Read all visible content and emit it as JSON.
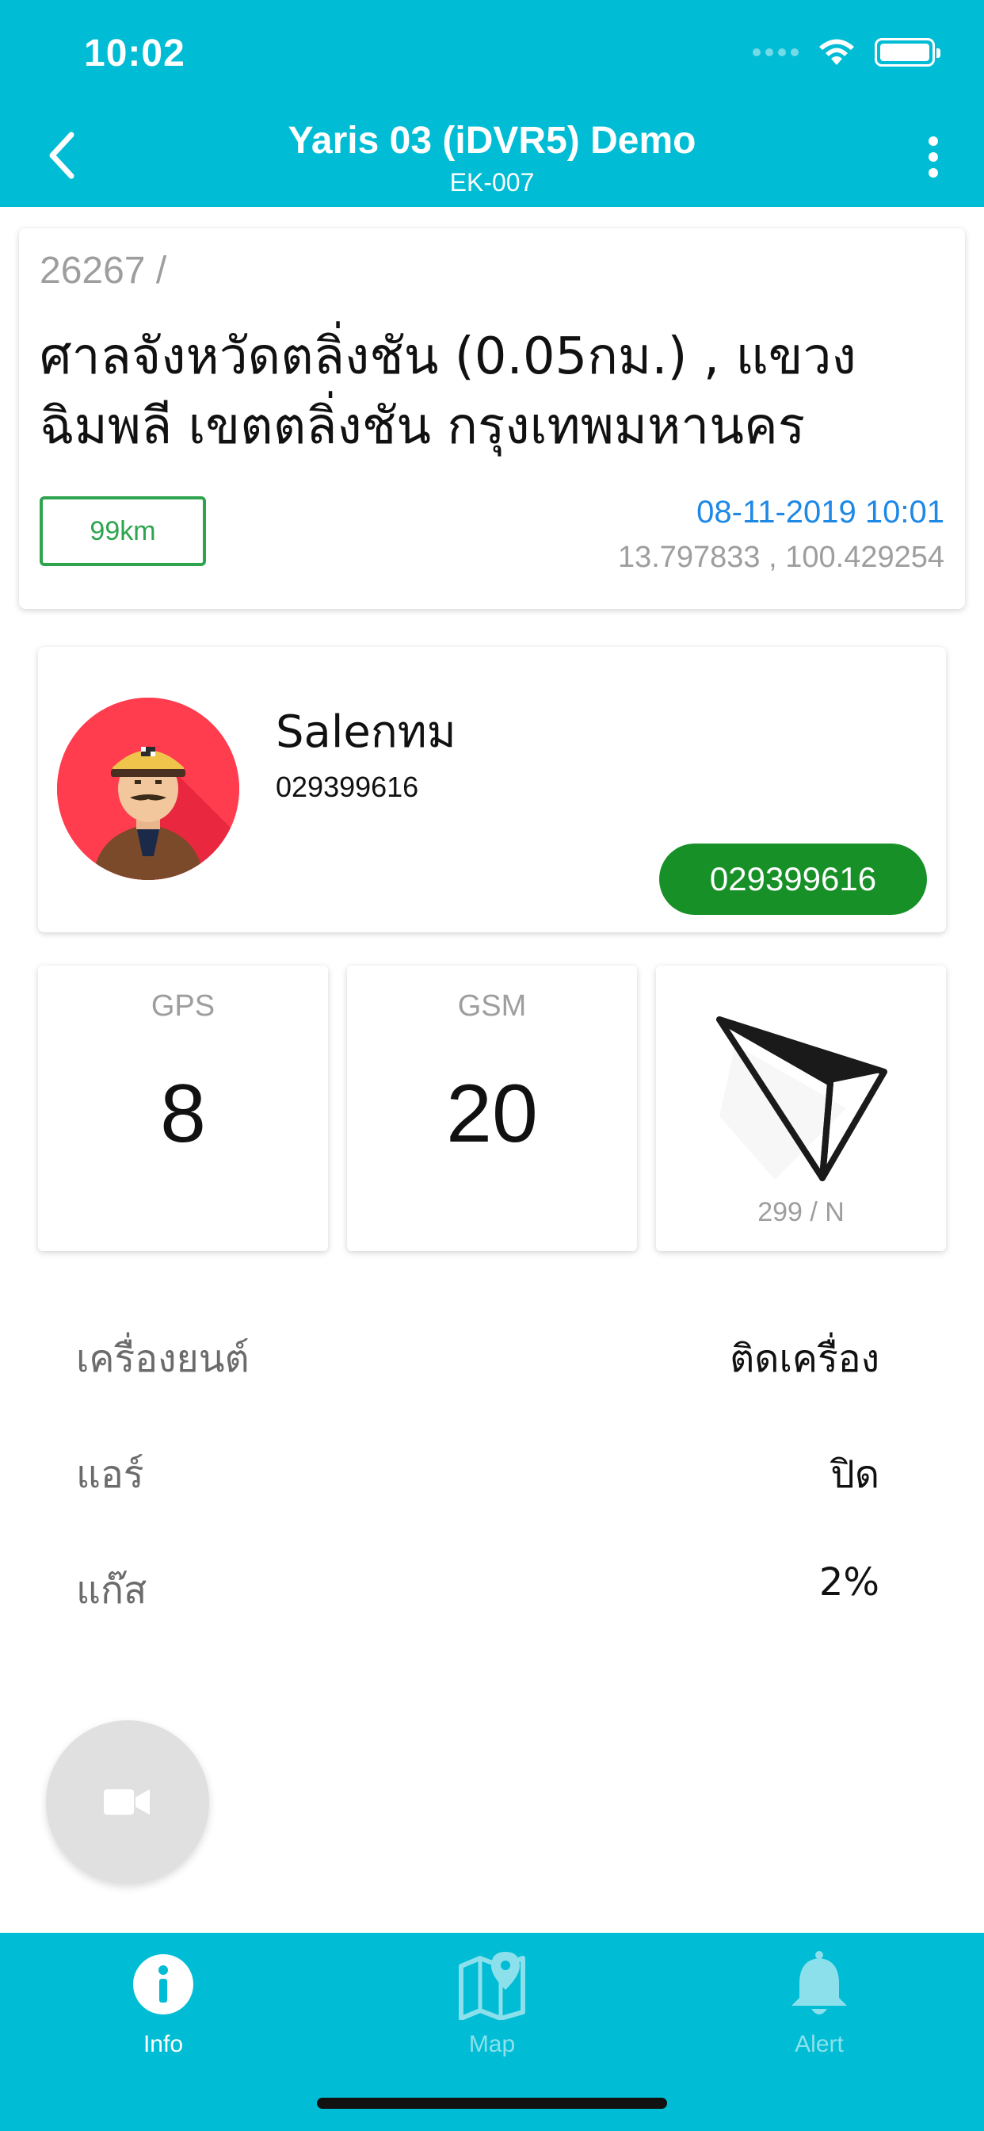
{
  "status_bar": {
    "time": "10:02"
  },
  "header": {
    "title": "Yaris 03 (iDVR5) Demo",
    "subtitle": "EK-007",
    "back_icon": "chevron-left-icon",
    "more_icon": "more-vertical-icon"
  },
  "location": {
    "id_line": "26267 /",
    "address": "ศาลจังหวัดตลิ่งชัน (0.05กม.) , แขวงฉิมพลี เขตตลิ่งชัน กรุงเทพมหานคร",
    "speed": "99km",
    "datetime": "08-11-2019 10:01",
    "coordinates": "13.797833 , 100.429254"
  },
  "driver": {
    "name": "Saleกทม",
    "phone": "029399616",
    "call_button": "029399616",
    "avatar_icon": "driver-avatar-icon"
  },
  "stats": {
    "gps_label": "GPS",
    "gps_value": "8",
    "gsm_label": "GSM",
    "gsm_value": "20",
    "heading_label": "299 / N",
    "heading_degrees": 299
  },
  "info_rows": [
    {
      "key": "เครื่องยนต์",
      "value": "ติดเครื่อง"
    },
    {
      "key": "แอร์",
      "value": "ปิด"
    },
    {
      "key": "แก๊ส",
      "value": "2%"
    }
  ],
  "fab": {
    "icon": "video-camera-icon"
  },
  "tabs": [
    {
      "label": "Info",
      "icon": "info-icon",
      "active": true
    },
    {
      "label": "Map",
      "icon": "map-pin-icon",
      "active": false
    },
    {
      "label": "Alert",
      "icon": "bell-icon",
      "active": false
    }
  ],
  "colors": {
    "primary": "#00bcd4",
    "speed_green": "#2ea44f",
    "call_green": "#179127",
    "date_blue": "#1e88e5"
  }
}
